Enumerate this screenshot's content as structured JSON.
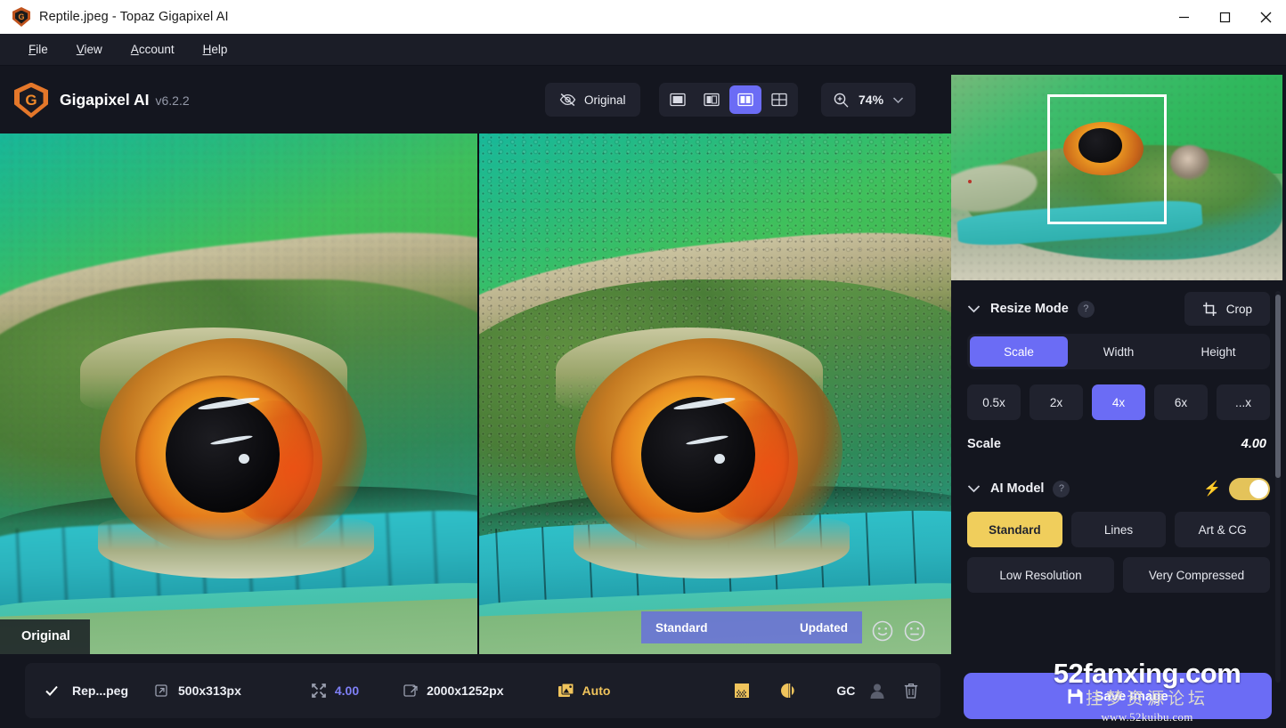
{
  "window": {
    "title": "Reptile.jpeg - Topaz Gigapixel AI",
    "logo_icon": "topaz-shield-icon",
    "controls": {
      "minimize": "minimize-icon",
      "maximize": "maximize-icon",
      "close": "close-icon"
    }
  },
  "menubar": {
    "items": [
      {
        "label": "File",
        "mnemonic": "F",
        "rest": "ile"
      },
      {
        "label": "View",
        "mnemonic": "V",
        "rest": "iew"
      },
      {
        "label": "Account",
        "mnemonic": "A",
        "rest": "ccount"
      },
      {
        "label": "Help",
        "mnemonic": "H",
        "rest": "elp"
      }
    ]
  },
  "appbar": {
    "brand_letter": "G",
    "brand_name": "Gigapixel AI",
    "version": "v6.2.2",
    "original_button": {
      "label": "Original",
      "icon": "eye-slash-icon"
    },
    "view_modes": [
      {
        "name": "single-view",
        "icon": "single-pane-icon",
        "active": false
      },
      {
        "name": "split-view",
        "icon": "split-pane-icon",
        "active": false
      },
      {
        "name": "side-by-side-view",
        "icon": "side-by-side-icon",
        "active": true
      },
      {
        "name": "grid-view",
        "icon": "grid-pane-icon",
        "active": false
      }
    ],
    "zoom": {
      "icon": "zoom-in-icon",
      "value": "74%",
      "caret": "chevron-down-icon"
    }
  },
  "canvas": {
    "left_label": "Original",
    "compare_bar": {
      "model": "Standard",
      "status": "Updated"
    },
    "feedback": {
      "positive": "smiley-face-icon",
      "negative": "neutral-face-icon"
    }
  },
  "panel": {
    "navigator": {
      "icon": "navigator-thumbnail",
      "selection": "viewport-rect"
    },
    "resize": {
      "title": "Resize Mode",
      "collapse_icon": "chevron-down-icon",
      "help": "?",
      "crop": {
        "label": "Crop",
        "icon": "crop-icon"
      },
      "modes": [
        {
          "label": "Scale",
          "active": true
        },
        {
          "label": "Width",
          "active": false
        },
        {
          "label": "Height",
          "active": false
        }
      ],
      "presets": [
        {
          "label": "0.5x",
          "active": false
        },
        {
          "label": "2x",
          "active": false
        },
        {
          "label": "4x",
          "active": true
        },
        {
          "label": "6x",
          "active": false
        },
        {
          "label": "...x",
          "active": false
        }
      ],
      "scale_key": "Scale",
      "scale_value": "4.00"
    },
    "ai_model": {
      "title": "AI Model",
      "collapse_icon": "chevron-down-icon",
      "help": "?",
      "bolt_icon": "lightning-bolt-icon",
      "toggle_on": true,
      "models_row1": [
        {
          "label": "Standard",
          "active": true
        },
        {
          "label": "Lines",
          "active": false
        },
        {
          "label": "Art & CG",
          "active": false
        }
      ],
      "models_row2": [
        {
          "label": "Low Resolution",
          "active": false
        },
        {
          "label": "Very Compressed",
          "active": false
        }
      ]
    },
    "save": {
      "label": "Save Image",
      "icon": "save-disk-icon"
    }
  },
  "statusbar": {
    "check_icon": "checkmark-icon",
    "filename": "Rep...peg",
    "input_icon": "image-in-icon",
    "input_size": "500x313px",
    "scale_icon": "resize-arrows-icon",
    "scale": "4.00",
    "output_icon": "image-out-icon",
    "output_size": "2000x1252px",
    "auto_icon": "photos-icon",
    "auto_label": "Auto",
    "noise_icon": "grain-icon",
    "contrast_icon": "contrast-icon",
    "gc_label": "GC",
    "face_icon": "person-icon",
    "delete_icon": "trash-icon"
  },
  "watermark": {
    "line1": "52fanxing.com",
    "line2": "挂梦资源论坛",
    "line3": "www.52kuibu.com"
  },
  "colors": {
    "accent_blue": "#6b6cf5",
    "accent_gold": "#f0ce5c",
    "panel_bg": "#14161f",
    "chip_bg": "#20222e",
    "titlebar_bg": "#ffffff"
  }
}
